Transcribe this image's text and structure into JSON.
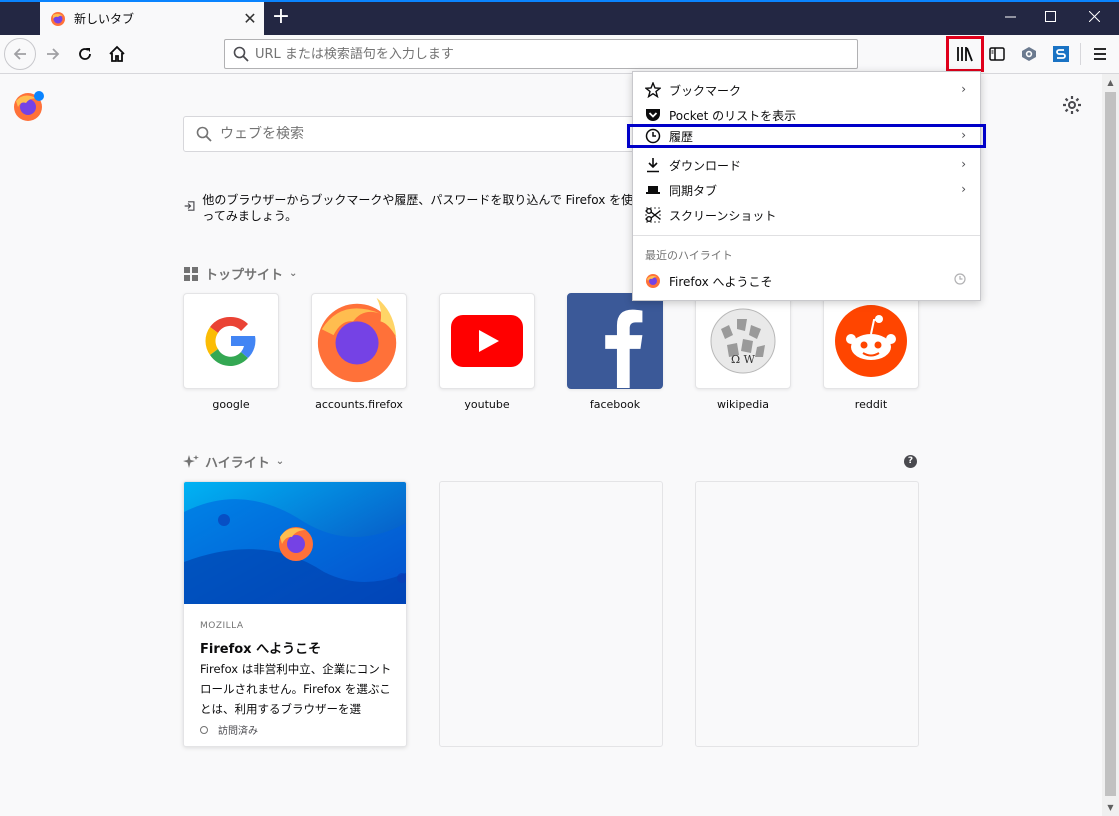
{
  "tab": {
    "title": "新しいタブ",
    "close": "✕",
    "new_tab": "+"
  },
  "window": {
    "minimize": "—",
    "maximize": "☐",
    "close": "✕"
  },
  "navbar": {
    "url_placeholder": "URL または検索語句を入力します"
  },
  "search": {
    "placeholder": "ウェブを検索"
  },
  "import_message": "他のブラウザーからブックマークや履歴、パスワードを取り込んで Firefox を使ってみましょう。",
  "top_sites": {
    "title": "トップサイト",
    "tiles": [
      {
        "label": "google",
        "icon": "google-icon"
      },
      {
        "label": "accounts.firefox",
        "icon": "firefox-icon"
      },
      {
        "label": "youtube",
        "icon": "youtube-icon"
      },
      {
        "label": "facebook",
        "icon": "facebook-icon"
      },
      {
        "label": "wikipedia",
        "icon": "wikipedia-icon"
      },
      {
        "label": "reddit",
        "icon": "reddit-icon"
      }
    ]
  },
  "highlights": {
    "title": "ハイライト",
    "help": "?",
    "card": {
      "source": "MOZILLA",
      "title": "Firefox へようこそ",
      "description": "Firefox は非営利中立、企業にコントロールされません。Firefox を選ぶことは、利用するブラウザーを選",
      "status": "訪問済み"
    }
  },
  "library_menu": {
    "items": [
      {
        "label": "ブックマーク",
        "icon": "star-icon",
        "has_arrow": true
      },
      {
        "label": "Pocket のリストを表示",
        "icon": "pocket-icon",
        "has_arrow": false
      },
      {
        "label": "履歴",
        "icon": "clock-icon",
        "has_arrow": true,
        "highlighted": true
      },
      {
        "label": "ダウンロード",
        "icon": "download-icon",
        "has_arrow": true
      },
      {
        "label": "同期タブ",
        "icon": "synced-tabs-icon",
        "has_arrow": true
      },
      {
        "label": "スクリーンショット",
        "icon": "scissors-icon",
        "has_arrow": false
      }
    ],
    "recent_heading": "最近のハイライト",
    "recent_item": "Firefox へようこそ",
    "arrow": "›"
  },
  "colors": {
    "tabbar": "#232743",
    "library_highlight": "#e0001b",
    "history_highlight": "#0000c8",
    "accent": "#0a84ff"
  }
}
